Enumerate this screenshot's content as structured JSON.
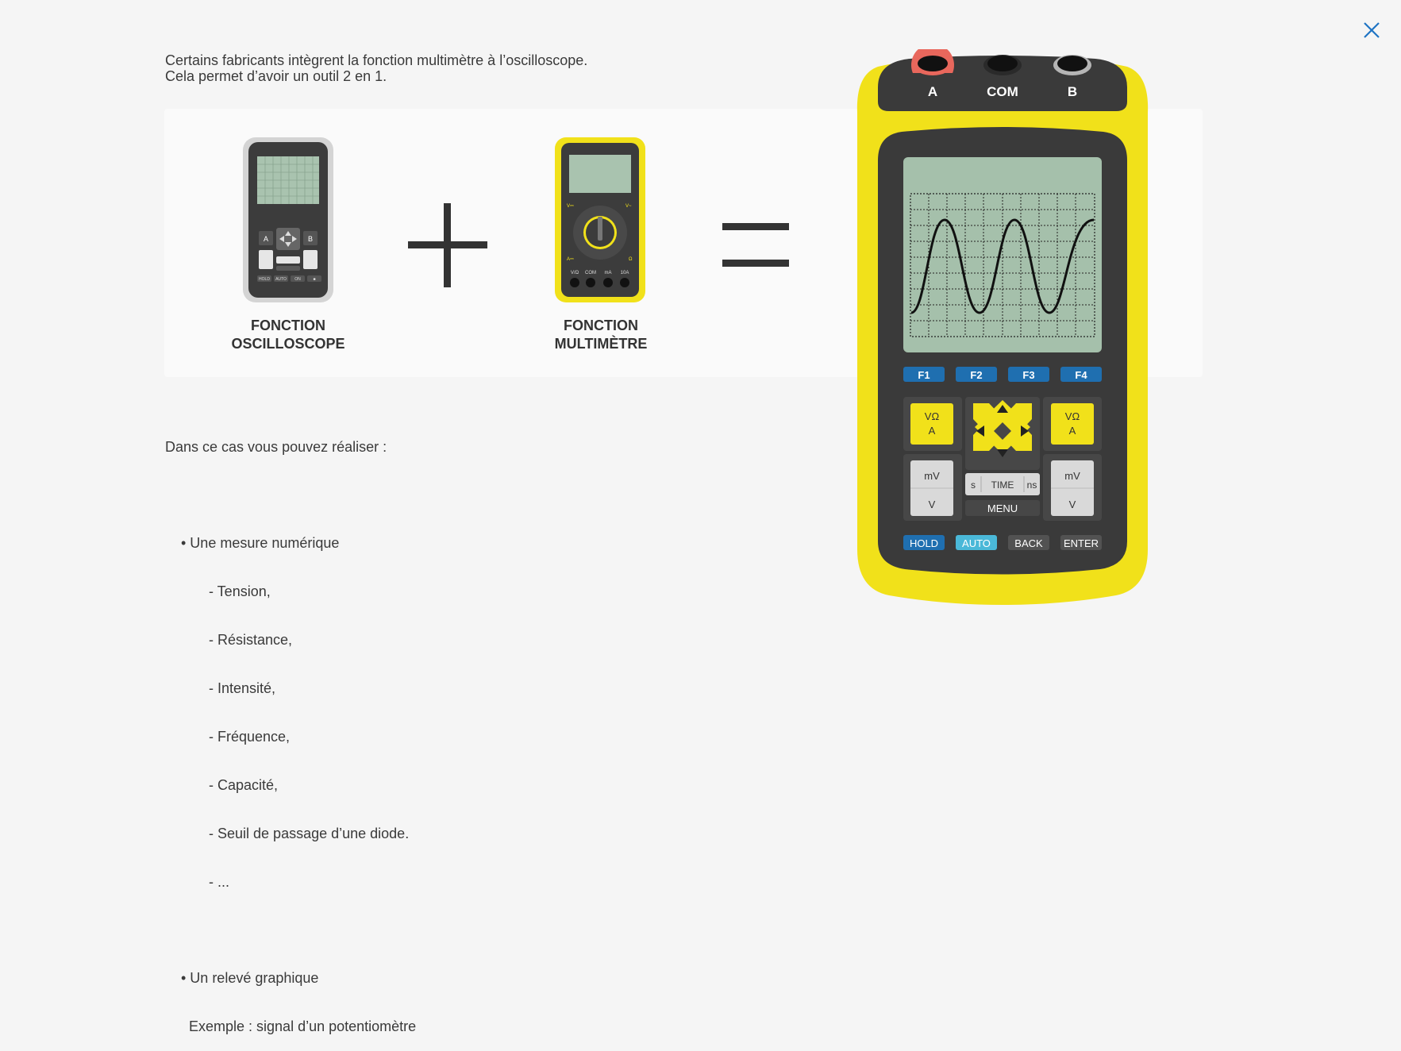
{
  "close_icon": "close-icon",
  "intro": {
    "line1": "Certains fabricants intègrent la fonction multimètre à l’oscilloscope.",
    "line2": "Cela permet d’avoir un outil 2 en 1."
  },
  "equation": {
    "oscilloscope_label_1": "FONCTION",
    "oscilloscope_label_2": "OSCILLOSCOPE",
    "multimeter_label_1": "FONCTION",
    "multimeter_label_2": "MULTIMÈTRE",
    "plus_symbol": "plus-icon",
    "equals_symbol": "equals-icon"
  },
  "oscillo_small": {
    "btn_a": "A",
    "btn_b": "B",
    "bottom": [
      "HOLD",
      "AUTO",
      "ON",
      "■"
    ]
  },
  "multi_small": {
    "jacks": [
      "V/Ω",
      "COM",
      "mA",
      "10A"
    ],
    "corner_tl": "V⎓",
    "corner_tr": "V~",
    "corner_bl": "A⎓",
    "corner_br": "Ω"
  },
  "description": {
    "lines": [
      "Dans ce cas vous pouvez réaliser :",
      "",
      "    • Une mesure numérique",
      "           - Tension,",
      "           - Résistance,",
      "           - Intensité,",
      "           - Fréquence,",
      "           - Capacité,",
      "           - Seuil de passage d’une diode.",
      "           - ...",
      "",
      "    • Un relevé graphique",
      "      Exemple : signal d’un potentiomètre"
    ]
  },
  "device": {
    "jacks": [
      "A",
      "COM",
      "B"
    ],
    "function_keys": [
      "F1",
      "F2",
      "F3",
      "F4"
    ],
    "left_top": [
      "VΩ",
      "A"
    ],
    "right_top": [
      "VΩ",
      "A"
    ],
    "left_bottom": [
      "mV",
      "V"
    ],
    "right_bottom": [
      "mV",
      "V"
    ],
    "time_s": "s",
    "time_label": "TIME",
    "time_ns": "ns",
    "menu": "MENU",
    "bottom_keys": [
      "HOLD",
      "AUTO",
      "BACK",
      "ENTER"
    ],
    "colors": {
      "body": "#f1e11a",
      "dark": "#3a3a3a",
      "screen": "#a5c0ab",
      "fkey": "#1f6fb0",
      "auto": "#4ab8d8",
      "jack_a": "#e8675c",
      "jack_b": "#b5b5b5"
    }
  }
}
